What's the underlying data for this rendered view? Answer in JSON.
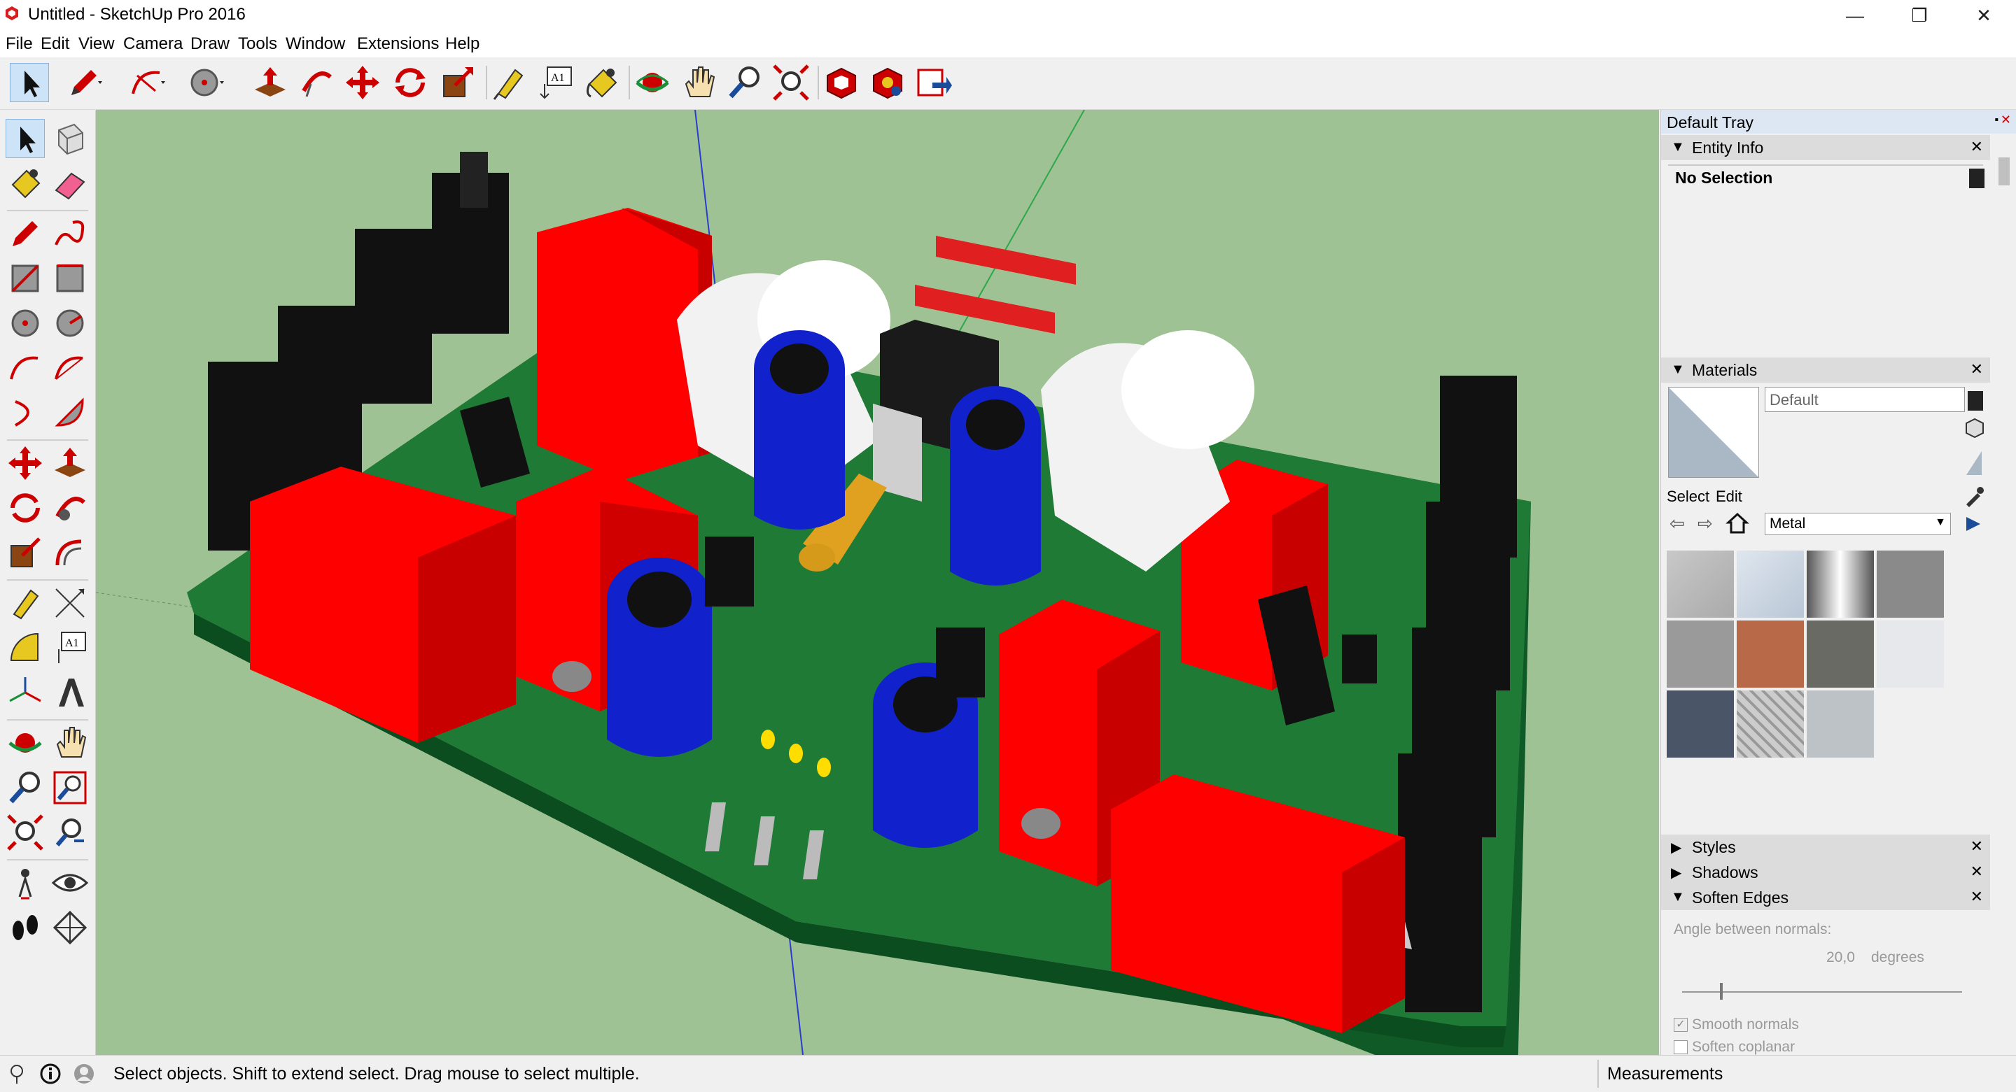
{
  "window": {
    "title": "Untitled - SketchUp Pro 2016",
    "minimize": "—",
    "restore": "❐",
    "close": "✕"
  },
  "menu": [
    "File",
    "Edit",
    "View",
    "Camera",
    "Draw",
    "Tools",
    "Window",
    "Extensions",
    "Help"
  ],
  "toolbar_icons": [
    "select-icon",
    "pencil-icon",
    "arc-icon",
    "circle-icon",
    "push-pull-icon",
    "follow-me-icon",
    "move-icon",
    "rotate-icon",
    "scale-icon",
    "tape-measure-icon",
    "text-icon",
    "paint-bucket-icon",
    "orbit-icon",
    "pan-icon",
    "zoom-icon",
    "zoom-extents-icon",
    "warehouse-icon",
    "extension-warehouse-icon",
    "send-to-layout-icon"
  ],
  "left_tools": [
    "select-icon",
    "component-icon",
    "paint-bucket-icon",
    "eraser-icon",
    "pencil-icon",
    "freehand-icon",
    "rectangle-icon",
    "rotated-rectangle-icon",
    "circle-icon",
    "polygon-icon",
    "arc-icon",
    "two-point-arc-icon",
    "pie-icon",
    "three-point-arc-icon",
    "move-icon",
    "push-pull-icon",
    "rotate-icon",
    "follow-me-icon",
    "scale-icon",
    "offset-icon",
    "tape-measure-icon",
    "dimension-icon",
    "protractor-icon",
    "text-icon",
    "axes-icon",
    "3d-text-icon",
    "orbit-icon",
    "pan-icon",
    "zoom-icon",
    "zoom-window-icon",
    "zoom-extents-icon",
    "previous-view-icon",
    "position-camera-icon",
    "look-around-icon",
    "walk-icon",
    "section-plane-icon"
  ],
  "tray": {
    "title": "Default Tray",
    "entity_info": {
      "label": "Entity Info",
      "selection": "No Selection"
    },
    "materials": {
      "label": "Materials",
      "current": "Default",
      "tab_select": "Select",
      "tab_edit": "Edit",
      "library": "Metal"
    },
    "styles": {
      "label": "Styles"
    },
    "shadows": {
      "label": "Shadows"
    },
    "soften_edges": {
      "label": "Soften Edges",
      "angle_label": "Angle between normals:",
      "angle_value": "20,0",
      "angle_unit": "degrees",
      "smooth_normals": "Smooth normals",
      "soften_coplanar": "Soften coplanar"
    }
  },
  "status": {
    "message": "Select objects. Shift to extend select. Drag mouse to select multiple.",
    "measurements": "Measurements"
  },
  "colors": {
    "viewport_bg": "#9ec294",
    "pcb_green": "#1f7a35",
    "component_red": "#ff0000",
    "capacitor_blue": "#1122cc",
    "heatsink_black": "#111111"
  }
}
